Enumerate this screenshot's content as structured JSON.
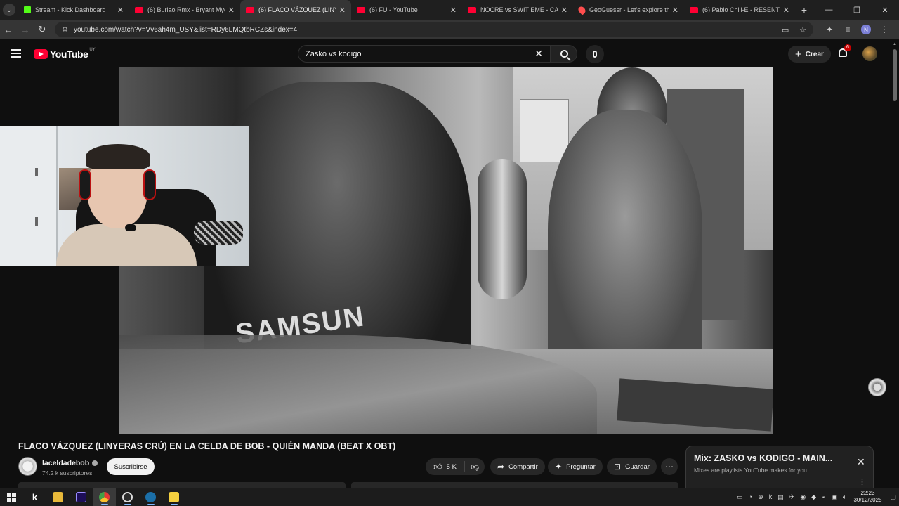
{
  "browser": {
    "tabs": [
      {
        "title": "Stream - Kick Dashboard",
        "icon": "kick-icon",
        "active": false
      },
      {
        "title": "(6) Burlao Rmx - Bryant Myers x",
        "icon": "youtube-icon",
        "active": false
      },
      {
        "title": "(6) FLACO VÁZQUEZ (LINYE",
        "icon": "youtube-icon",
        "active": true
      },
      {
        "title": "(6) FU - YouTube",
        "icon": "youtube-icon",
        "active": false
      },
      {
        "title": "NOCRE vs SWIT EME - CARTELI",
        "icon": "youtube-icon",
        "active": false
      },
      {
        "title": "GeoGuessr - Let's explore the w",
        "icon": "geoguessr-icon",
        "active": false
      },
      {
        "title": "(6) Pablo Chill-E - RESENTIA - Y",
        "icon": "youtube-icon",
        "active": false
      }
    ],
    "url": "youtube.com/watch?v=Vv6ah4m_USY&list=RDy6LMQtbRCZs&index=4",
    "profile_initial": "N"
  },
  "youtube": {
    "logo_text": "YouTube",
    "country_code": "UY",
    "search_query": "Zasko vs kodigo",
    "create_label": "Crear",
    "notification_count": "6"
  },
  "video": {
    "title": "FLACO VÁZQUEZ (LINYERAS CRÚ) EN LA CELDA DE BOB - QUIÉN MANDA (BEAT X OBT)",
    "shirt_text": "SAMSUN"
  },
  "channel": {
    "name": "laceldadebob",
    "subscribers": "74.2 k suscriptores",
    "subscribe_label": "Suscribirse"
  },
  "actions": {
    "likes": "5 K",
    "share_label": "Compartir",
    "ask_label": "Preguntar",
    "save_label": "Guardar"
  },
  "mix": {
    "title": "Mix: ZASKO vs KODIGO - MAIN...",
    "subtitle": "Mixes are playlists YouTube makes for you"
  },
  "taskbar": {
    "time": "22:23",
    "date": "30/12/2025"
  }
}
